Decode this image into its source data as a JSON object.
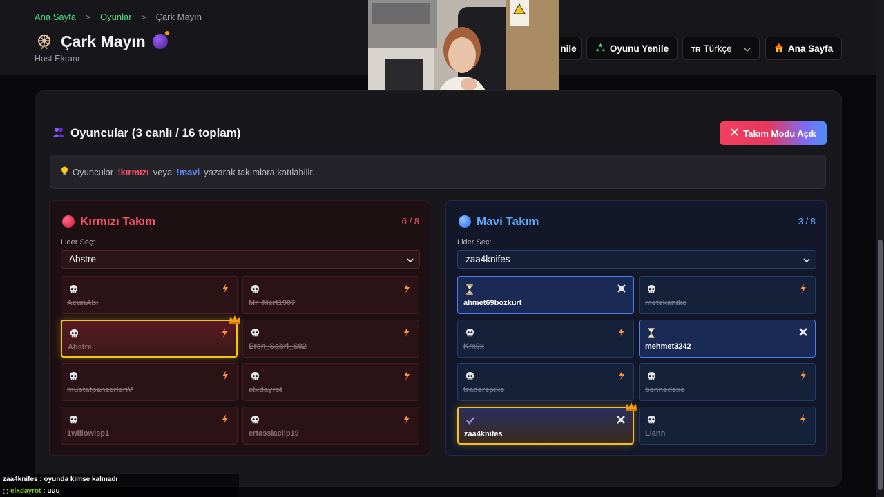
{
  "breadcrumb": {
    "home": "Ana Sayfa",
    "games": "Oyunlar",
    "current": "Çark Mayın"
  },
  "header": {
    "title": "Çark Mayın",
    "subtitle": "Host Ekranı"
  },
  "buttons": {
    "partial": "nile",
    "restart_game": "Oyunu Yenile",
    "language": "Türkçe",
    "language_flag": "TR",
    "home": "Ana Sayfa",
    "team_mode": "Takım Modu Açık"
  },
  "players_section": {
    "title": "Oyuncular (3 canlı / 16 toplam)"
  },
  "info": {
    "prefix": "Oyuncular",
    "red_cmd": "!kırmızı",
    "middle": "veya",
    "blue_cmd": "!mavi",
    "suffix": "yazarak takımlara katılabilir."
  },
  "red_team": {
    "name": "Kırmızı Takım",
    "count": "0 / 8",
    "leader_label": "Lider Seç:",
    "leader": "Abstre",
    "players": [
      {
        "name": "AcunAbi",
        "status": "dead"
      },
      {
        "name": "Mr_Mert1907",
        "status": "dead"
      },
      {
        "name": "Abstre",
        "status": "dead",
        "leader": true
      },
      {
        "name": "Eren_Sabri_S02",
        "status": "dead"
      },
      {
        "name": "mustafpanzerleriV",
        "status": "dead"
      },
      {
        "name": "elxdayrot",
        "status": "dead"
      },
      {
        "name": "1willowisp1",
        "status": "dead"
      },
      {
        "name": "ertasslaclip19",
        "status": "dead"
      }
    ]
  },
  "blue_team": {
    "name": "Mavi Takım",
    "count": "3 / 8",
    "leader_label": "Lider Seç:",
    "leader": "zaa4knifes",
    "players": [
      {
        "name": "ahmet69bozkurt",
        "status": "waiting"
      },
      {
        "name": "metekaniko",
        "status": "dead"
      },
      {
        "name": "Km0x",
        "status": "dead"
      },
      {
        "name": "mehmet3242",
        "status": "waiting"
      },
      {
        "name": "traderspike",
        "status": "dead"
      },
      {
        "name": "bennedexe",
        "status": "dead"
      },
      {
        "name": "zaa4knifes",
        "status": "done",
        "leader": true
      },
      {
        "name": "Llann",
        "status": "dead"
      }
    ]
  },
  "chat": [
    {
      "user": "zaa4knifes",
      "sep": ":",
      "message": "oyunda kimse kalmadı"
    },
    {
      "user": "elxdayrot",
      "sep": ":",
      "message": "uuu"
    }
  ],
  "colors": {
    "accent_green": "#4ade80",
    "red_team": "#fb5368",
    "blue_team": "#60a5fa",
    "leader_gold": "#f6c21b"
  }
}
